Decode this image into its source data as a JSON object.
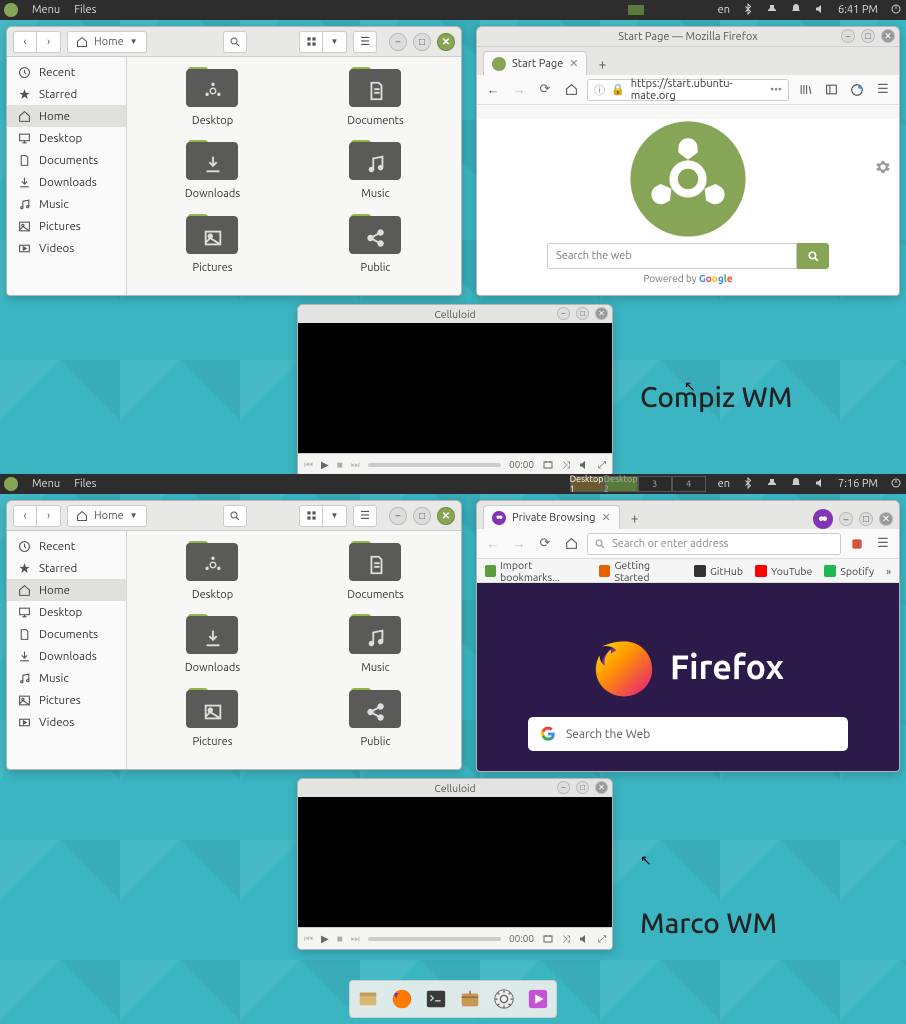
{
  "screens": [
    {
      "label": "Compiz WM",
      "time": "6:41 PM",
      "lang": "en"
    },
    {
      "label": "Marco WM",
      "time": "7:16 PM",
      "lang": "en"
    }
  ],
  "panel": {
    "menu": "Menu",
    "files": "Files",
    "workspaces": [
      "Desktop 1",
      "Desktop 2",
      "3",
      "4"
    ]
  },
  "fileManager": {
    "location": "Home",
    "sidebar": [
      {
        "icon": "clock-icon",
        "label": "Recent"
      },
      {
        "icon": "star-icon",
        "label": "Starred"
      },
      {
        "icon": "home-icon",
        "label": "Home",
        "selected": true
      },
      {
        "icon": "monitor-icon",
        "label": "Desktop"
      },
      {
        "icon": "document-icon",
        "label": "Documents"
      },
      {
        "icon": "download-icon",
        "label": "Downloads"
      },
      {
        "icon": "music-icon",
        "label": "Music"
      },
      {
        "icon": "image-icon",
        "label": "Pictures"
      },
      {
        "icon": "video-icon",
        "label": "Videos"
      }
    ],
    "folders": [
      {
        "name": "Desktop",
        "glyph": "ubuntu"
      },
      {
        "name": "Documents",
        "glyph": "doc"
      },
      {
        "name": "Downloads",
        "glyph": "dl"
      },
      {
        "name": "Music",
        "glyph": "music"
      },
      {
        "name": "Pictures",
        "glyph": "pic"
      },
      {
        "name": "Public",
        "glyph": "share"
      }
    ]
  },
  "firefox1": {
    "windowTitle": "Start Page — Mozilla Firefox",
    "tab": "Start Page",
    "url": "https://start.ubuntu-mate.org",
    "searchPlaceholder": "Search the web",
    "poweredBy": "Powered by",
    "poweredLogo": "Google"
  },
  "firefox2": {
    "tab": "Private Browsing",
    "urlPlaceholder": "Search or enter address",
    "bookmarks": [
      {
        "label": "Import bookmarks...",
        "color": "#5a9e3e"
      },
      {
        "label": "Getting Started",
        "color": "#e66000"
      },
      {
        "label": "GitHub",
        "color": "#333"
      },
      {
        "label": "YouTube",
        "color": "#f00"
      },
      {
        "label": "Spotify",
        "color": "#1db954"
      }
    ],
    "brand": "Firefox",
    "searchPlaceholder": "Search the Web"
  },
  "celluloid": {
    "title": "Celluloid",
    "time": "00:00"
  },
  "dock": [
    {
      "name": "files-app",
      "color": "#d9b877"
    },
    {
      "name": "firefox-app",
      "color": "#ff7b00"
    },
    {
      "name": "terminal-app",
      "color": "#3a3a3a"
    },
    {
      "name": "software-app",
      "color": "#c89752"
    },
    {
      "name": "settings-app",
      "color": "#666"
    },
    {
      "name": "media-app",
      "color": "#c453d6"
    }
  ]
}
